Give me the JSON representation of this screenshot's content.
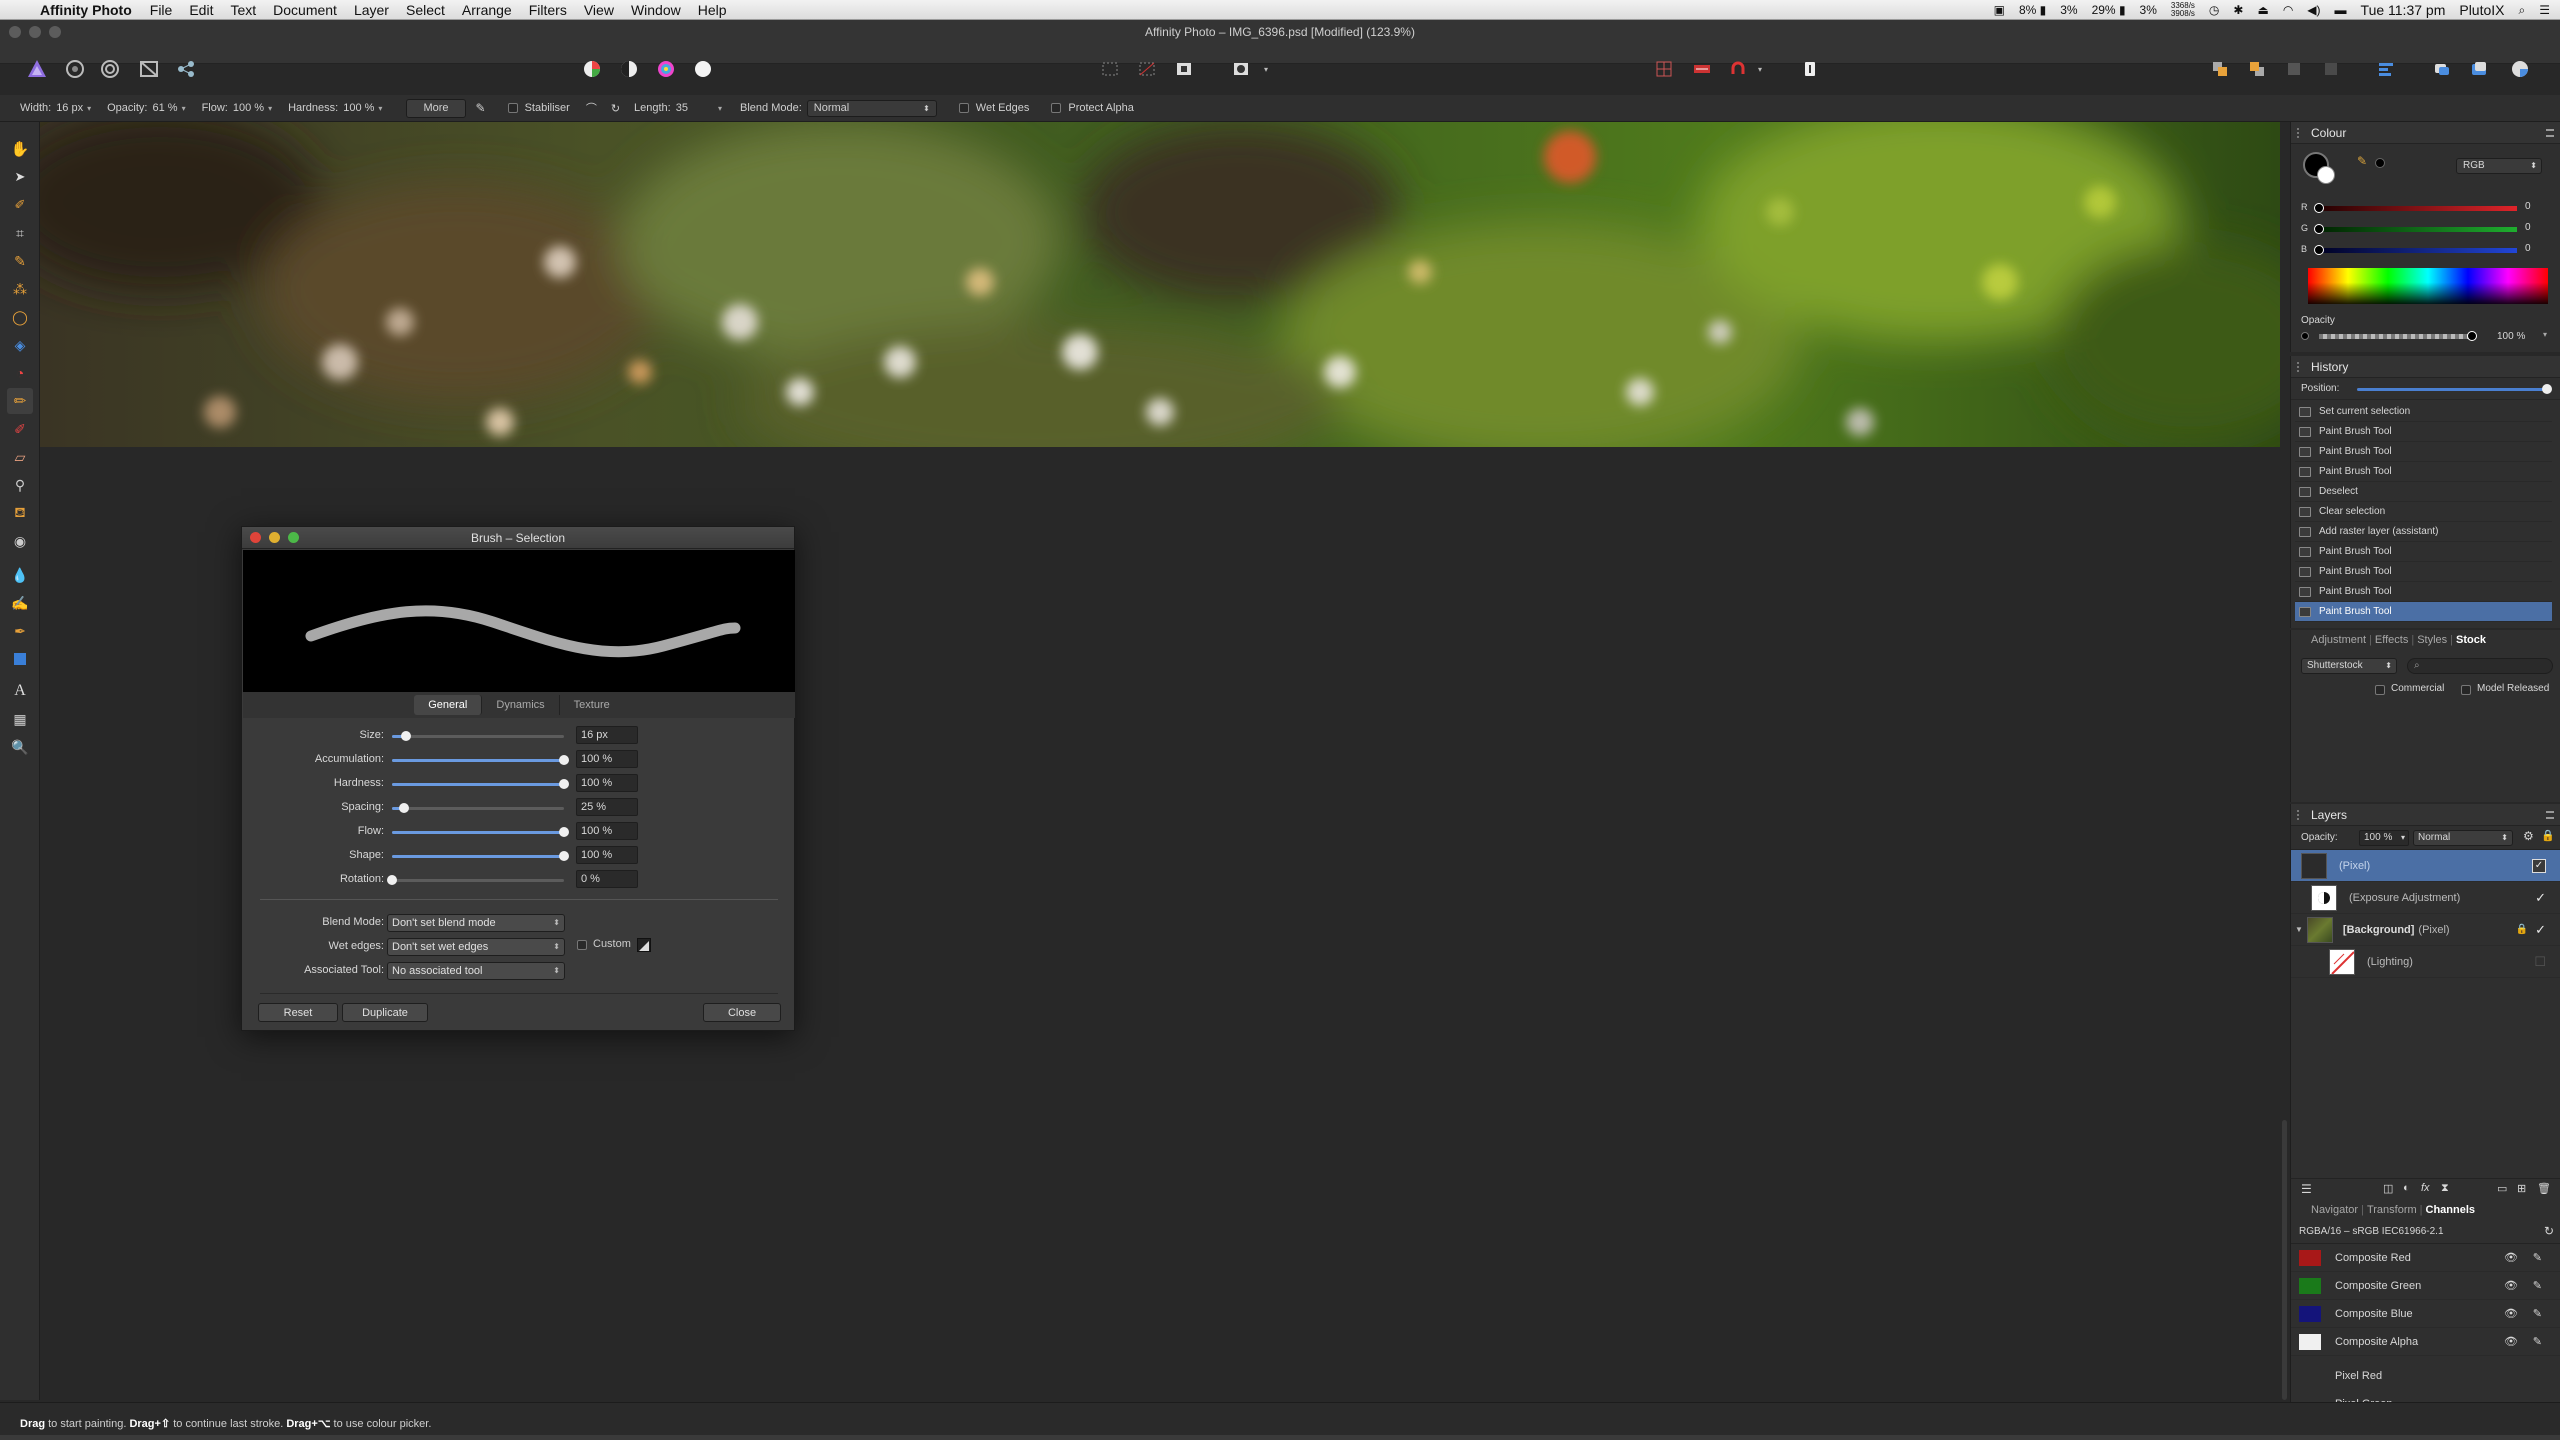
{
  "menubar": {
    "app_name": "Affinity Photo",
    "items": [
      "File",
      "Edit",
      "Text",
      "Document",
      "Layer",
      "Select",
      "Arrange",
      "Filters",
      "View",
      "Window",
      "Help"
    ],
    "status": {
      "cpu1": "8%",
      "cpu2": "3%",
      "mem1": "29%",
      "mem2": "3%",
      "net_up": "3368/s",
      "net_down": "3908/s",
      "clock": "Tue 11:37 pm",
      "user": "PlutoIX"
    }
  },
  "window": {
    "title": "Affinity Photo – IMG_6396.psd [Modified] (123.9%)"
  },
  "context_toolbar": {
    "width_label": "Width:",
    "width_value": "16 px",
    "opacity_label": "Opacity:",
    "opacity_value": "61 %",
    "flow_label": "Flow:",
    "flow_value": "100 %",
    "hardness_label": "Hardness:",
    "hardness_value": "100 %",
    "more_label": "More",
    "stabiliser_label": "Stabiliser",
    "length_label": "Length:",
    "length_value": "35",
    "blend_label": "Blend Mode:",
    "blend_value": "Normal",
    "wet_edges_label": "Wet Edges",
    "protect_alpha_label": "Protect Alpha"
  },
  "status_bar": {
    "k1": "Drag",
    "t1": " to start painting. ",
    "k2": "Drag+⇧",
    "t2": " to continue last stroke. ",
    "k3": "Drag+⌥",
    "t3": " to use colour picker."
  },
  "colour_panel": {
    "title": "Colour",
    "mode": "RGB",
    "r_label": "R",
    "r_value": "0",
    "g_label": "G",
    "g_value": "0",
    "b_label": "B",
    "b_value": "0",
    "opacity_label": "Opacity",
    "opacity_value": "100 %",
    "colors": {
      "r": "#e0242a",
      "g": "#1fae2f",
      "b": "#2246d8"
    }
  },
  "history_panel": {
    "title": "History",
    "position_label": "Position:",
    "items": [
      "Set current selection",
      "Paint Brush Tool",
      "Paint Brush Tool",
      "Paint Brush Tool",
      "Deselect",
      "Clear selection",
      "Add raster layer (assistant)",
      "Paint Brush Tool",
      "Paint Brush Tool",
      "Paint Brush Tool",
      "Paint Brush Tool"
    ],
    "selected_index": 10
  },
  "stock_panel": {
    "tabs": [
      "Adjustment",
      "Effects",
      "Styles",
      "Stock"
    ],
    "source": "Shutterstock",
    "commercial_label": "Commercial",
    "model_released_label": "Model Released"
  },
  "layers_panel": {
    "title": "Layers",
    "opacity_label": "Opacity:",
    "opacity_value": "100 %",
    "blend_value": "Normal",
    "layers": [
      {
        "name": "(Pixel)",
        "selected": true
      },
      {
        "name": "(Exposure Adjustment)"
      },
      {
        "name": "[Background]",
        "sub": "(Pixel)"
      },
      {
        "name": "(Lighting)"
      }
    ]
  },
  "channels_panel": {
    "tabs": [
      "Navigator",
      "Transform",
      "Channels"
    ],
    "profile": "RGBA/16 – sRGB IEC61966-2.1",
    "channels": [
      {
        "name": "Composite Red",
        "color": "#a81818"
      },
      {
        "name": "Composite Green",
        "color": "#1a7a1a"
      },
      {
        "name": "Composite Blue",
        "color": "#14147a"
      },
      {
        "name": "Composite Alpha",
        "color": "#f0f0f0"
      }
    ],
    "pixel_channels": [
      "Pixel Red",
      "Pixel Green"
    ]
  },
  "brush_dialog": {
    "title": "Brush – Selection",
    "tabs": [
      "General",
      "Dynamics",
      "Texture"
    ],
    "params": [
      {
        "label": "Size:",
        "value": "16 px",
        "level": 0.08
      },
      {
        "label": "Accumulation:",
        "value": "100 %",
        "level": 1.0
      },
      {
        "label": "Hardness:",
        "value": "100 %",
        "level": 1.0
      },
      {
        "label": "Spacing:",
        "value": "25 %",
        "level": 0.07
      },
      {
        "label": "Flow:",
        "value": "100 %",
        "level": 1.0
      },
      {
        "label": "Shape:",
        "value": "100 %",
        "level": 1.0
      },
      {
        "label": "Rotation:",
        "value": "0 %",
        "level": 0.0
      }
    ],
    "blend_mode_label": "Blend Mode:",
    "blend_mode_value": "Don't set blend mode",
    "wet_edges_label": "Wet edges:",
    "wet_edges_value": "Don't set wet edges",
    "custom_label": "Custom",
    "assoc_label": "Associated Tool:",
    "assoc_value": "No associated tool",
    "reset_label": "Reset",
    "duplicate_label": "Duplicate",
    "close_label": "Close"
  }
}
